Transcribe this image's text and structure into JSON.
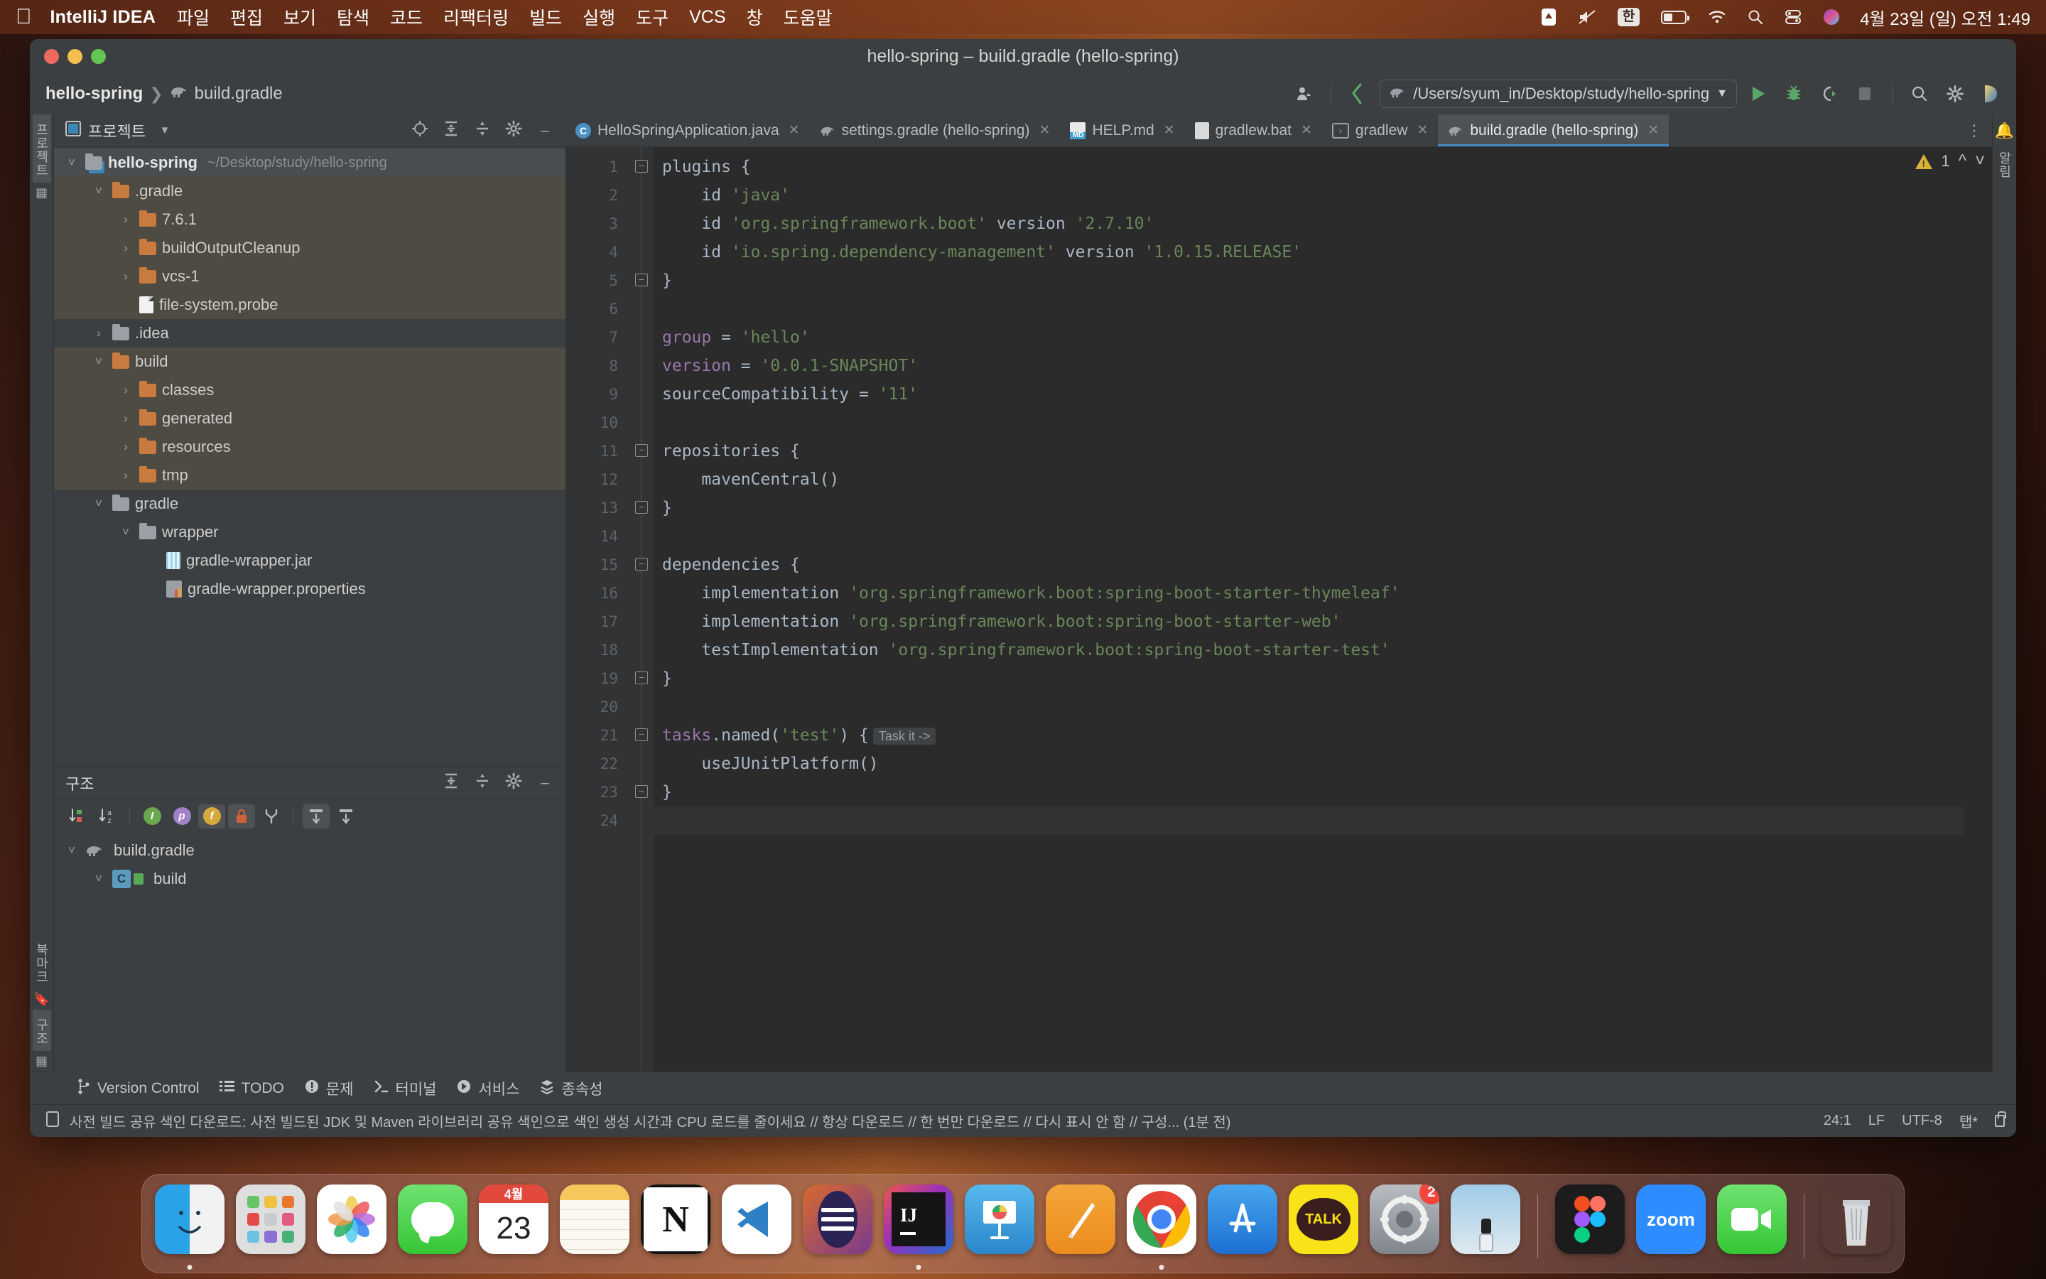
{
  "menubar": {
    "apple_icon": "apple-icon",
    "app_name": "IntelliJ IDEA",
    "items": [
      "파일",
      "편집",
      "보기",
      "탐색",
      "코드",
      "리팩터링",
      "빌드",
      "실행",
      "도구",
      "VCS",
      "창",
      "도움말"
    ],
    "status_icons": [
      "dropbox-icon",
      "mute-icon",
      "input-source-icon",
      "battery-icon",
      "wifi-icon",
      "spotlight-icon",
      "control-center-icon",
      "siri-icon"
    ],
    "input_source": "한",
    "clock": "4월 23일 (일) 오전 1:49"
  },
  "window": {
    "title": "hello-spring – build.gradle (hello-spring)",
    "traffic": [
      "close-button",
      "minimize-button",
      "zoom-button"
    ]
  },
  "navbar": {
    "breadcrumb_project": "hello-spring",
    "breadcrumb_sep": "❯",
    "breadcrumb_file": "build.gradle",
    "run_config": "/Users/syum_in/Desktop/study/hello-spring",
    "run_config_icon": "gradle-elephant-icon",
    "dropdown_icon": "chevron-down-icon",
    "buttons": [
      "account-icon",
      "updates-icon",
      "run-icon",
      "debug-icon",
      "run-with-coverage-icon",
      "stop-icon",
      "search-everywhere-icon",
      "settings-icon",
      "ai-assistant-icon"
    ]
  },
  "left_strip": {
    "project_label": "프로젝트",
    "bookmarks_label": "북마크",
    "structure_label": "구조"
  },
  "right_strip": {
    "notifications_label": "알림",
    "bell_icon": "bell-icon"
  },
  "project_panel": {
    "title": "프로젝트",
    "title_icon": "project-icon",
    "dropdown_icon": "chevron-down-icon",
    "actions": [
      "select-opened-file-icon",
      "expand-all-icon",
      "collapse-all-icon",
      "settings-icon",
      "hide-icon"
    ],
    "tree": [
      {
        "label": "hello-spring",
        "path": "~/Desktop/study/hello-spring",
        "indent": 0,
        "arrow": "v",
        "icon": "module-folder",
        "bold": true,
        "selected_mark": true
      },
      {
        "label": ".gradle",
        "indent": 1,
        "arrow": "v",
        "icon": "folder-orange",
        "highlight": true
      },
      {
        "label": "7.6.1",
        "indent": 2,
        "arrow": ">",
        "icon": "folder-orange",
        "highlight": true
      },
      {
        "label": "buildOutputCleanup",
        "indent": 2,
        "arrow": ">",
        "icon": "folder-orange",
        "highlight": true
      },
      {
        "label": "vcs-1",
        "indent": 2,
        "arrow": ">",
        "icon": "folder-orange",
        "highlight": true
      },
      {
        "label": "file-system.probe",
        "indent": 2,
        "arrow": "",
        "icon": "file",
        "highlight": true
      },
      {
        "label": ".idea",
        "indent": 1,
        "arrow": ">",
        "icon": "folder-gray"
      },
      {
        "label": "build",
        "indent": 1,
        "arrow": "v",
        "icon": "folder-orange",
        "highlight": true
      },
      {
        "label": "classes",
        "indent": 2,
        "arrow": ">",
        "icon": "folder-orange",
        "highlight": true
      },
      {
        "label": "generated",
        "indent": 2,
        "arrow": ">",
        "icon": "folder-orange",
        "highlight": true
      },
      {
        "label": "resources",
        "indent": 2,
        "arrow": ">",
        "icon": "folder-orange",
        "highlight": true
      },
      {
        "label": "tmp",
        "indent": 2,
        "arrow": ">",
        "icon": "folder-orange",
        "highlight": true
      },
      {
        "label": "gradle",
        "indent": 1,
        "arrow": "v",
        "icon": "folder-gray"
      },
      {
        "label": "wrapper",
        "indent": 2,
        "arrow": "v",
        "icon": "folder-gray"
      },
      {
        "label": "gradle-wrapper.jar",
        "indent": 3,
        "arrow": "",
        "icon": "jar"
      },
      {
        "label": "gradle-wrapper.properties",
        "indent": 3,
        "arrow": "",
        "icon": "properties"
      }
    ]
  },
  "structure_panel": {
    "title": "구조",
    "actions": [
      "expand-all-icon",
      "collapse-all-icon",
      "settings-icon",
      "hide-icon"
    ],
    "toolbar": [
      "sort-by-visibility-icon",
      "sort-alphabetically-icon",
      "show-inherited-icon",
      "show-properties-icon",
      "show-fields-icon",
      "show-non-public-icon",
      "group-icon",
      "scroll-from-source-icon",
      "scroll-to-source-icon"
    ],
    "tree": [
      {
        "label": "build.gradle",
        "indent": 0,
        "arrow": "v",
        "icon": "gradle-elephant"
      },
      {
        "label": "build",
        "indent": 1,
        "arrow": "v",
        "icon": "class-c"
      }
    ]
  },
  "tabs": [
    {
      "label": "HelloSpringApplication.java",
      "icon": "java-class-icon",
      "active": false,
      "close": "✕"
    },
    {
      "label": "settings.gradle (hello-spring)",
      "icon": "gradle-elephant-icon",
      "active": false,
      "close": "✕"
    },
    {
      "label": "HELP.md",
      "icon": "markdown-icon",
      "active": false,
      "close": "✕"
    },
    {
      "label": "gradlew.bat",
      "icon": "bat-file-icon",
      "active": false,
      "close": "✕"
    },
    {
      "label": "gradlew",
      "icon": "shell-script-icon",
      "active": false,
      "close": "✕"
    },
    {
      "label": "build.gradle (hello-spring)",
      "icon": "gradle-elephant-icon",
      "active": true,
      "close": "✕"
    }
  ],
  "tabs_more_icon": "more-options-icon",
  "inspections": {
    "warning_count": "1",
    "warning_icon": "warning-triangle-icon",
    "prev_icon": "chevron-up-icon",
    "next_icon": "chevron-down-icon"
  },
  "editor": {
    "filename": "build.gradle",
    "line_count": 24,
    "cursor_line": 24,
    "lines": [
      {
        "n": 1,
        "fold": "start",
        "tokens": [
          {
            "t": "plugins {",
            "c": "plain"
          }
        ]
      },
      {
        "n": 2,
        "tokens": [
          {
            "t": "    id ",
            "c": "plain"
          },
          {
            "t": "'java'",
            "c": "str"
          }
        ]
      },
      {
        "n": 3,
        "tokens": [
          {
            "t": "    id ",
            "c": "plain"
          },
          {
            "t": "'org.springframework.boot'",
            "c": "str"
          },
          {
            "t": " version ",
            "c": "plain"
          },
          {
            "t": "'2.7.10'",
            "c": "str"
          }
        ]
      },
      {
        "n": 4,
        "tokens": [
          {
            "t": "    id ",
            "c": "plain"
          },
          {
            "t": "'io.spring.dependency-management'",
            "c": "str"
          },
          {
            "t": " version ",
            "c": "plain"
          },
          {
            "t": "'1.0.15.RELEASE'",
            "c": "str"
          }
        ]
      },
      {
        "n": 5,
        "fold": "end",
        "tokens": [
          {
            "t": "}",
            "c": "plain"
          }
        ]
      },
      {
        "n": 6,
        "tokens": []
      },
      {
        "n": 7,
        "tokens": [
          {
            "t": "group",
            "c": "prop"
          },
          {
            "t": " = ",
            "c": "plain"
          },
          {
            "t": "'hello'",
            "c": "str"
          }
        ]
      },
      {
        "n": 8,
        "tokens": [
          {
            "t": "version",
            "c": "prop"
          },
          {
            "t": " = ",
            "c": "plain"
          },
          {
            "t": "'0.0.1-SNAPSHOT'",
            "c": "str"
          }
        ]
      },
      {
        "n": 9,
        "tokens": [
          {
            "t": "sourceCompatibility = ",
            "c": "plain"
          },
          {
            "t": "'11'",
            "c": "str"
          }
        ]
      },
      {
        "n": 10,
        "tokens": []
      },
      {
        "n": 11,
        "fold": "start",
        "tokens": [
          {
            "t": "repositories {",
            "c": "plain"
          }
        ]
      },
      {
        "n": 12,
        "tokens": [
          {
            "t": "    mavenCentral()",
            "c": "plain"
          }
        ]
      },
      {
        "n": 13,
        "fold": "end",
        "tokens": [
          {
            "t": "}",
            "c": "plain"
          }
        ]
      },
      {
        "n": 14,
        "tokens": []
      },
      {
        "n": 15,
        "fold": "start",
        "run_marker": true,
        "tokens": [
          {
            "t": "dependencies {",
            "c": "plain"
          }
        ]
      },
      {
        "n": 16,
        "tokens": [
          {
            "t": "    implementation ",
            "c": "plain"
          },
          {
            "t": "'org.springframework.boot:spring-boot-starter-thymeleaf'",
            "c": "str"
          }
        ]
      },
      {
        "n": 17,
        "tokens": [
          {
            "t": "    implementation ",
            "c": "plain"
          },
          {
            "t": "'org.springframework.boot:spring-boot-starter-web'",
            "c": "str"
          }
        ]
      },
      {
        "n": 18,
        "tokens": [
          {
            "t": "    testImplementation ",
            "c": "plain"
          },
          {
            "t": "'org.springframework.boot:spring-boot-starter-test'",
            "c": "str"
          }
        ]
      },
      {
        "n": 19,
        "fold": "end",
        "tokens": [
          {
            "t": "}",
            "c": "plain"
          }
        ]
      },
      {
        "n": 20,
        "tokens": []
      },
      {
        "n": 21,
        "fold": "start",
        "inlay": "Task it ->",
        "tokens": [
          {
            "t": "tasks",
            "c": "prop"
          },
          {
            "t": ".named(",
            "c": "plain"
          },
          {
            "t": "'test'",
            "c": "str"
          },
          {
            "t": ") {",
            "c": "plain"
          }
        ]
      },
      {
        "n": 22,
        "tokens": [
          {
            "t": "    useJUnitPlatform()",
            "c": "plain"
          }
        ]
      },
      {
        "n": 23,
        "fold": "end",
        "tokens": [
          {
            "t": "}",
            "c": "plain"
          }
        ]
      },
      {
        "n": 24,
        "current": true,
        "tokens": []
      }
    ]
  },
  "toolstrip": [
    {
      "label": "Version Control",
      "icon": "branch-icon"
    },
    {
      "label": "TODO",
      "icon": "todo-list-icon"
    },
    {
      "label": "문제",
      "icon": "problems-icon"
    },
    {
      "label": "터미널",
      "icon": "terminal-icon"
    },
    {
      "label": "서비스",
      "icon": "services-icon"
    },
    {
      "label": "종속성",
      "icon": "dependencies-icon"
    }
  ],
  "statusbar": {
    "message_icon": "notification-icon",
    "message": "사전 빌드 공유 색인 다운로드: 사전 빌드된 JDK 및 Maven 라이브러리 공유 색인으로 색인 생성 시간과 CPU 로드를 줄이세요 // 항상 다운로드 // 한 번만 다운로드 // 다시 표시 안 함 // 구성... (1분 전)",
    "caret": "24:1",
    "line_separator": "LF",
    "encoding": "UTF-8",
    "indent": "탭*",
    "lock_icon": "read-only-lock-icon"
  },
  "dock": {
    "items": [
      {
        "name": "finder",
        "running": true
      },
      {
        "name": "launchpad",
        "running": false
      },
      {
        "name": "photos",
        "running": false
      },
      {
        "name": "messages",
        "running": false
      },
      {
        "name": "calendar",
        "running": false,
        "day": "23",
        "month": "4월"
      },
      {
        "name": "notes",
        "running": false
      },
      {
        "name": "notion",
        "running": false
      },
      {
        "name": "vscode",
        "running": false
      },
      {
        "name": "obsidian",
        "running": false
      },
      {
        "name": "intellij-idea",
        "running": true,
        "label": "IJ"
      },
      {
        "name": "keynote",
        "running": false
      },
      {
        "name": "preview",
        "running": false
      },
      {
        "name": "chrome",
        "running": true
      },
      {
        "name": "app-store",
        "running": false
      },
      {
        "name": "kakaotalk",
        "running": false,
        "label": "TALK"
      },
      {
        "name": "system-settings",
        "running": false,
        "badge": "2"
      },
      {
        "name": "screenshot",
        "running": false
      },
      {
        "name": "figma",
        "running": false
      },
      {
        "name": "zoom",
        "running": false,
        "label": "zoom"
      },
      {
        "name": "facetime",
        "running": false
      },
      {
        "name": "trash",
        "running": false
      }
    ]
  }
}
